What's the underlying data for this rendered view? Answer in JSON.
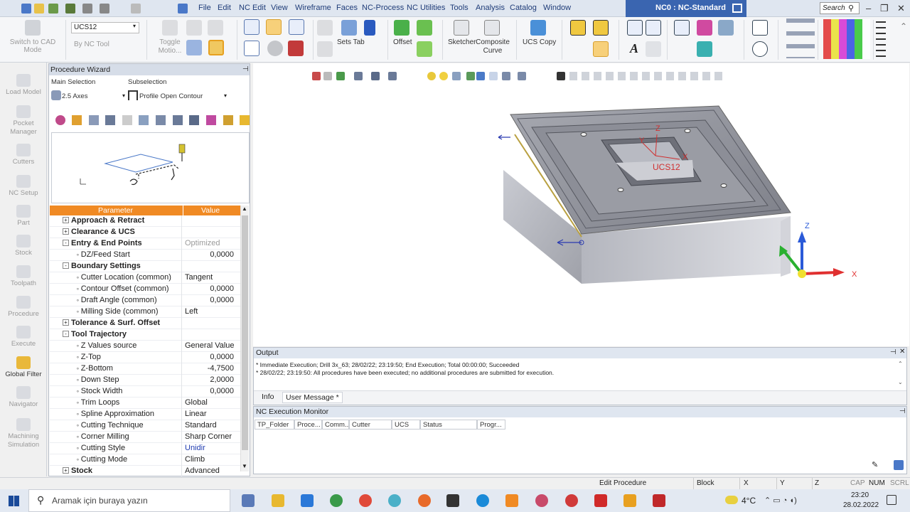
{
  "menu": [
    "File",
    "Edit",
    "NC Edit",
    "View",
    "Wireframe",
    "Faces",
    "NC-Process",
    "NC Utilities",
    "Tools",
    "Analysis",
    "Catalog",
    "Window"
  ],
  "title": "NC0 : NC-Standard",
  "search_placeholder": "Search",
  "ribbon": {
    "switch_cad": "Switch to CAD Mode",
    "ucs_value": "UCS12",
    "by_nc_tool": "By NC Tool",
    "toggle_motion": "Toggle Motio...",
    "sets_tab": "Sets Tab",
    "offset": "Offset",
    "sketcher": "Sketcher",
    "composite_curve": "Composite Curve",
    "ucs_copy": "UCS Copy"
  },
  "leftbar": [
    "Load Model",
    "Pocket Manager",
    "Cutters",
    "NC Setup",
    "Part",
    "Stock",
    "Toolpath",
    "Procedure",
    "Execute",
    "Global Filter",
    "Navigator",
    "Machining Simulation"
  ],
  "wizard": {
    "title": "Procedure Wizard",
    "main_selection_label": "Main Selection",
    "subselection_label": "Subselection",
    "main_selection_value": "2.5 Axes",
    "subselection_value": "Profile Open Contour",
    "col_param": "Parameter",
    "col_value": "Value",
    "rows": [
      {
        "label": "Approach & Retract",
        "value": "",
        "group": true,
        "sign": "+"
      },
      {
        "label": "Clearance & UCS",
        "value": "",
        "group": true,
        "sign": "+"
      },
      {
        "label": "Entry & End Points",
        "value": "Optimized",
        "group": true,
        "sign": "-",
        "style": "dimv"
      },
      {
        "label": "DZ/Feed Start",
        "value": "0,0000",
        "style": "num"
      },
      {
        "label": "Boundary Settings",
        "value": "",
        "group": true,
        "sign": "-"
      },
      {
        "label": "Cutter Location (common)",
        "value": "Tangent"
      },
      {
        "label": "Contour Offset (common)",
        "value": "0,0000",
        "style": "num"
      },
      {
        "label": "Draft Angle (common)",
        "value": "0,0000",
        "style": "num"
      },
      {
        "label": "Milling Side (common)",
        "value": "Left"
      },
      {
        "label": "Tolerance & Surf. Offset",
        "value": "",
        "group": true,
        "sign": "+"
      },
      {
        "label": "Tool Trajectory",
        "value": "",
        "group": true,
        "sign": "-"
      },
      {
        "label": "Z Values source",
        "value": "General Value"
      },
      {
        "label": "Z-Top",
        "value": "0,0000",
        "style": "num"
      },
      {
        "label": "Z-Bottom",
        "value": "-4,7500",
        "style": "num"
      },
      {
        "label": "Down Step",
        "value": "2,0000",
        "style": "num"
      },
      {
        "label": "Stock Width",
        "value": "0,0000",
        "style": "num"
      },
      {
        "label": "Trim Loops",
        "value": "Global"
      },
      {
        "label": "Spline Approximation",
        "value": "Linear"
      },
      {
        "label": "Cutting Technique",
        "value": "Standard"
      },
      {
        "label": "Corner Milling",
        "value": "Sharp Corner"
      },
      {
        "label": "Cutting Style",
        "value": "Unidir",
        "style": "blue"
      },
      {
        "label": "Cutting Mode",
        "value": "Climb"
      },
      {
        "label": "Stock",
        "value": "Advanced",
        "group": true,
        "sign": "+"
      }
    ]
  },
  "viewport": {
    "ucs_label": "UCS12",
    "axis_x": "X",
    "axis_y": "Y",
    "axis_z": "Z"
  },
  "output": {
    "title": "Output",
    "lines": [
      "* Immediate Execution; Drill 3x_63; 28/02/22; 23:19:50; End Execution; Total 00:00:00; Succeeded",
      "* 28/02/22; 23:19:50: All procedures have been executed; no additional procedures are submitted for execution."
    ],
    "tabs": [
      "Info",
      "User Message *"
    ]
  },
  "monitor": {
    "title": "NC Execution Monitor",
    "columns": [
      "TP_Folder",
      "Proce...",
      "Comm...",
      "Cutter",
      "UCS",
      "Status",
      "Progr..."
    ]
  },
  "statusbar": {
    "mode": "Edit Procedure",
    "block": "Block",
    "x": "X",
    "y": "Y",
    "z": "Z",
    "cap": "CAP",
    "num": "NUM",
    "scrl": "SCRL"
  },
  "taskbar": {
    "search": "Aramak için buraya yazın",
    "temp": "4°C",
    "time": "23:20",
    "date": "28.02.2022"
  },
  "colors": {
    "accent_orange": "#f08a24",
    "title_blue": "#3a65b0",
    "part_gray": "#8d8f98"
  }
}
